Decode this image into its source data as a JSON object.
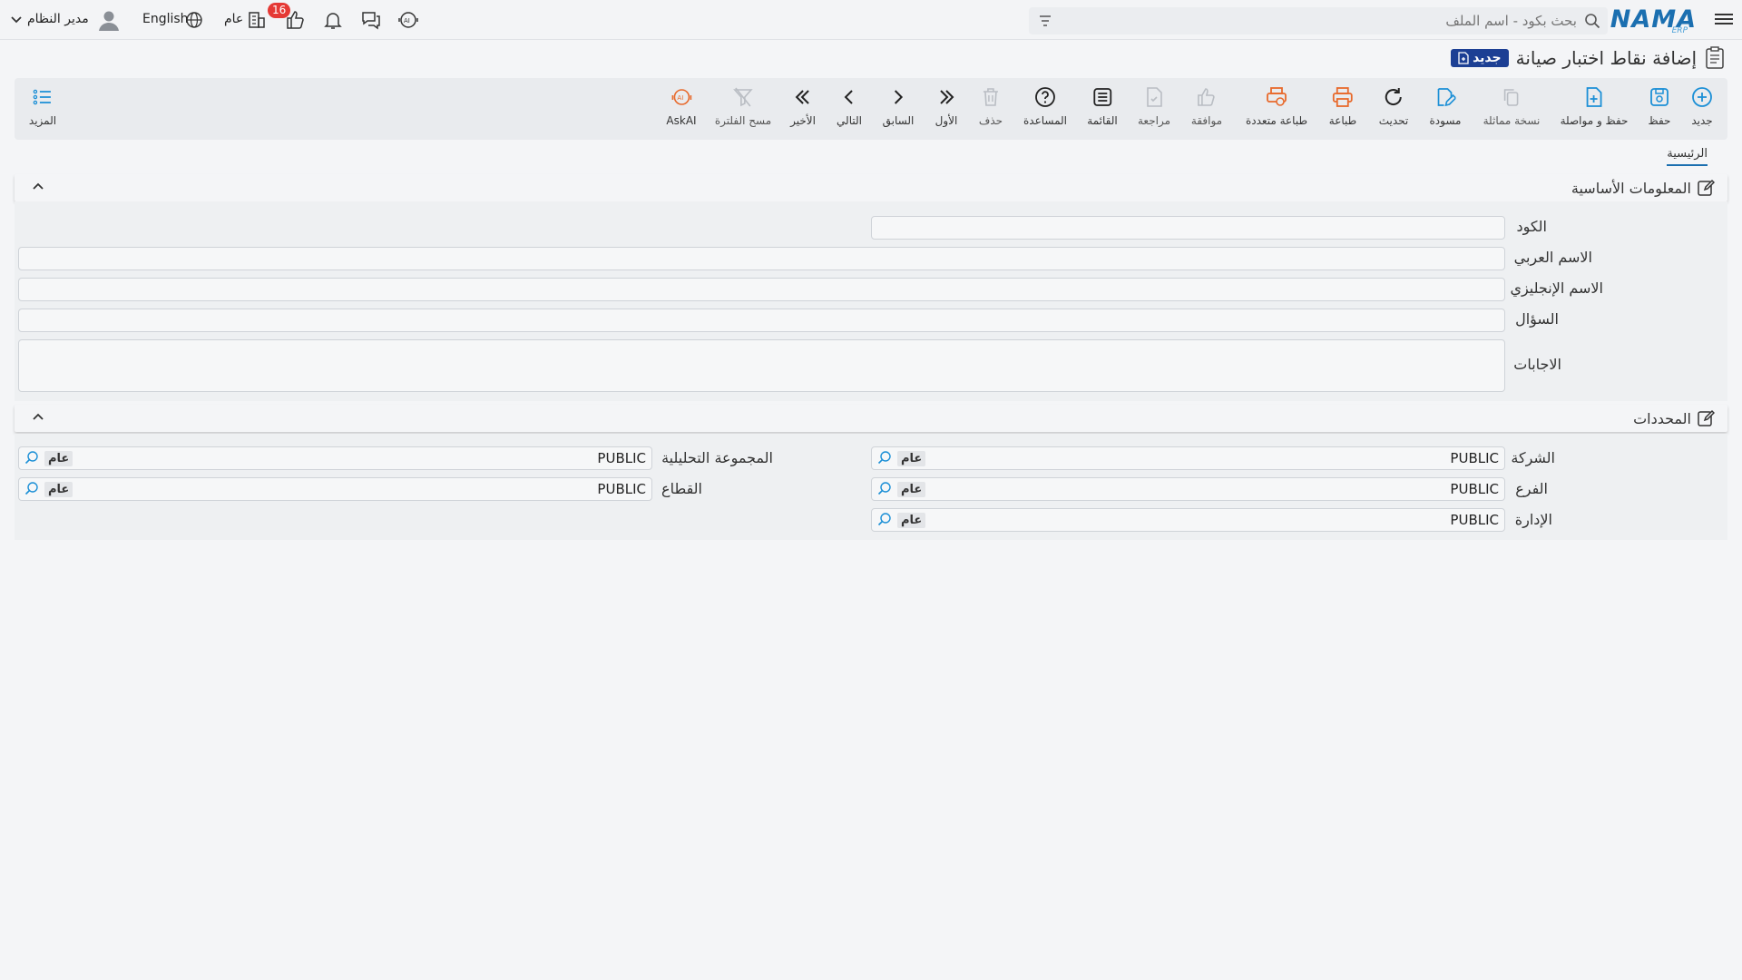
{
  "topbar": {
    "logo_text": "NAMA",
    "logo_sub": "ERP",
    "search_placeholder": "بحث بكود - اسم الملف",
    "notification_count": "16",
    "scope_label": "عام",
    "language_label": "English",
    "user_label": "مدير النظام",
    "icons": [
      "menu-icon",
      "search-icon",
      "filter-icon",
      "ai-icon",
      "chat-icon",
      "bell-icon",
      "like-icon",
      "org-icon",
      "globe-icon",
      "user-avatar-icon",
      "chevron-down-icon"
    ]
  },
  "page": {
    "title": "إضافة نقاط اختبار صيانة",
    "status_badge": "جديد"
  },
  "toolbar": {
    "new": "جديد",
    "save": "حفظ",
    "save_continue": "حفظ و مواصلة",
    "clone": "نسخة مماثلة",
    "draft": "مسودة",
    "refresh": "تحديث",
    "print": "طباعة",
    "multi_print": "طباعة متعددة",
    "approve": "موافقة",
    "review": "مراجعة",
    "list": "القائمة",
    "help": "المساعدة",
    "delete": "حذف",
    "first": "الأول",
    "previous": "السابق",
    "next": "التالي",
    "last": "الأخير",
    "clear_filter": "مسح الفلترة",
    "askai": "AskAI",
    "more": "المزيد",
    "colors": {
      "blue": "#1b8fd6",
      "orange": "#e8692b",
      "dark": "#222222",
      "disabled": "#b9bdc3"
    }
  },
  "tabs": {
    "main": "الرئيسية"
  },
  "basic_info": {
    "title": "المعلومات الأساسية",
    "code_label": "الكود",
    "arabic_name_label": "الاسم العربي",
    "english_name_label": "الاسم الإنجليزي",
    "question_label": "السؤال",
    "answers_label": "الاجابات",
    "code_value": "",
    "arabic_name_value": "",
    "english_name_value": "",
    "question_value": "",
    "answers_value": ""
  },
  "dimensions": {
    "title": "المحددات",
    "company_label": "الشركة",
    "branch_label": "الفرع",
    "department_label": "الإدارة",
    "analytic_group_label": "المجموعة التحليلية",
    "sector_label": "القطاع",
    "company_value": "PUBLIC",
    "branch_value": "PUBLIC",
    "department_value": "PUBLIC",
    "analytic_group_value": "PUBLIC",
    "sector_value": "PUBLIC",
    "chip_text": "عام"
  }
}
